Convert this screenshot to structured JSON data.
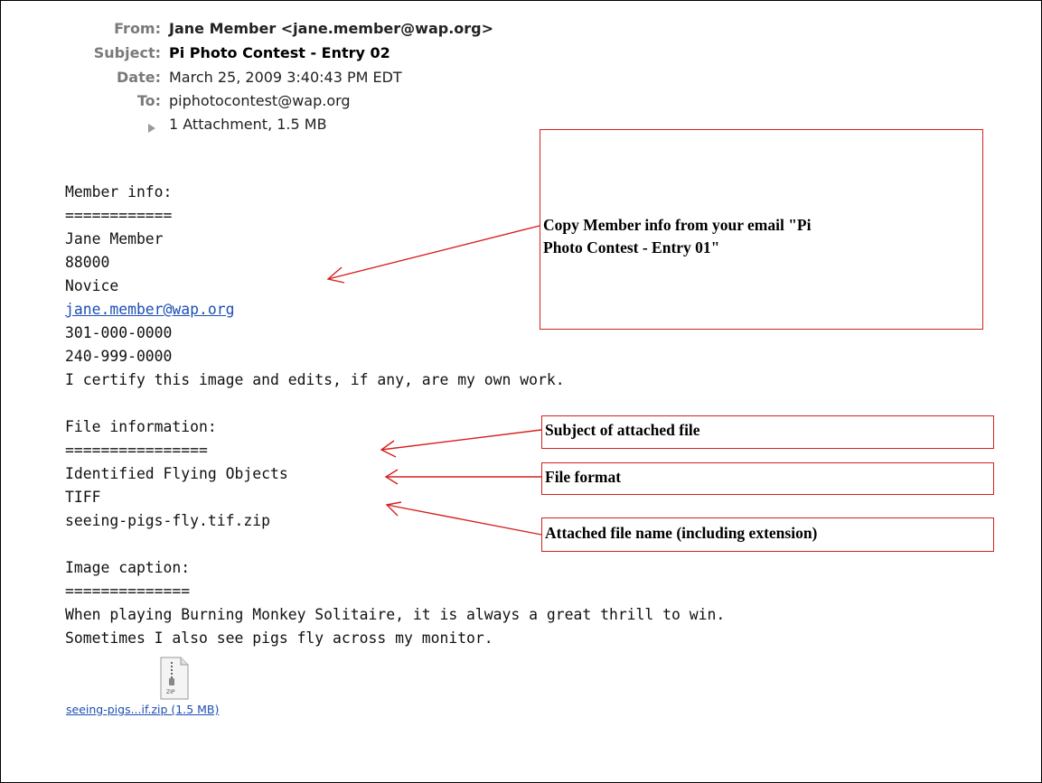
{
  "header": {
    "from_label": "From:",
    "from_value": "Jane Member <jane.member@wap.org>",
    "subject_label": "Subject:",
    "subject_value": "Pi Photo Contest - Entry 02",
    "date_label": "Date:",
    "date_value": "March 25, 2009 3:40:43 PM EDT",
    "to_label": "To:",
    "to_value": "piphotocontest@wap.org",
    "attachments_summary": "1 Attachment, 1.5 MB"
  },
  "body": {
    "member_info_heading": "Member info:",
    "member_info_rule": "============",
    "member_name": "Jane Member",
    "member_number": "88000",
    "member_level": "Novice",
    "member_email": "jane.member@wap.org",
    "phone_1": "301-000-0000",
    "phone_2": "240-999-0000",
    "certification": "I certify this image and edits, if any, are my own work.",
    "file_info_heading": "File information:",
    "file_info_rule": "================",
    "file_subject": "Identified Flying Objects",
    "file_format": "TIFF",
    "file_name": "seeing-pigs-fly.tif.zip",
    "caption_heading": "Image caption:",
    "caption_rule": "==============",
    "caption_line_1": "When playing Burning Monkey Solitaire, it is always a great thrill to win.",
    "caption_line_2": "Sometimes I also see pigs fly across my monitor."
  },
  "attachment": {
    "icon_text": "ZIP",
    "link_text": "seeing-pigs...if.zip (1.5 MB)"
  },
  "annotations": {
    "member_info_note_line_1": "Copy Member info from your email \"Pi",
    "member_info_note_line_2": "Photo Contest - Entry 01\"",
    "subject_note": "Subject of attached file",
    "format_note": "File format",
    "filename_note": "Attached file name (including extension)"
  },
  "colors": {
    "annotation_red": "#d62020",
    "link_blue": "#1d4fb5",
    "label_gray": "#7a7a7a"
  }
}
